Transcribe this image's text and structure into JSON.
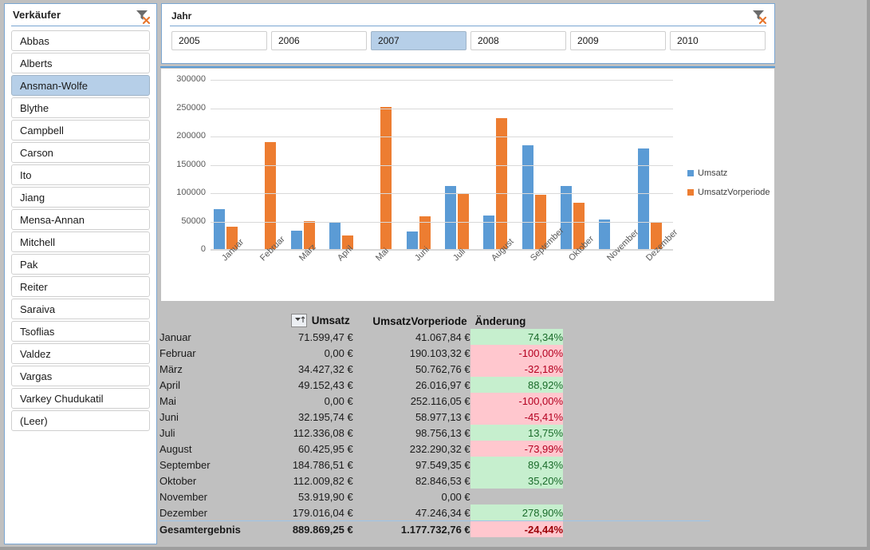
{
  "seller_slicer": {
    "title": "Verkäufer",
    "clear_filter_icon": "clear-filter-funnel-icon",
    "selected": "Ansman-Wolfe",
    "items": [
      "Abbas",
      "Alberts",
      "Ansman-Wolfe",
      "Blythe",
      "Campbell",
      "Carson",
      "Ito",
      "Jiang",
      "Mensa-Annan",
      "Mitchell",
      "Pak",
      "Reiter",
      "Saraiva",
      "Tsoflias",
      "Valdez",
      "Vargas",
      "Varkey Chudukatil",
      "(Leer)"
    ]
  },
  "year_slicer": {
    "title": "Jahr",
    "clear_filter_icon": "clear-filter-funnel-icon",
    "selected": "2007",
    "items": [
      "2005",
      "2006",
      "2007",
      "2008",
      "2009",
      "2010"
    ]
  },
  "chart_data": {
    "type": "bar",
    "title": "",
    "xlabel": "",
    "ylabel": "",
    "ylim": [
      0,
      300000
    ],
    "yticks": [
      0,
      50000,
      100000,
      150000,
      200000,
      250000,
      300000
    ],
    "ytick_labels": [
      "0",
      "50000",
      "100000",
      "150000",
      "200000",
      "250000",
      "300000"
    ],
    "grid": true,
    "legend_position": "right",
    "categories": [
      "Januar",
      "Februar",
      "März",
      "April",
      "Mai",
      "Juni",
      "Juli",
      "August",
      "September",
      "Oktober",
      "November",
      "Dezember"
    ],
    "series": [
      {
        "name": "Umsatz",
        "color": "#5b9bd5",
        "values": [
          71599.47,
          0,
          34427.32,
          49152.43,
          0,
          32195.74,
          112336.08,
          60425.95,
          184786.51,
          112009.82,
          53919.9,
          179016.04
        ]
      },
      {
        "name": "UmsatzVorperiode",
        "color": "#ed7d31",
        "values": [
          41067.84,
          190103.32,
          50762.76,
          26016.97,
          252116.05,
          58977.13,
          98756.13,
          232290.32,
          97549.35,
          82846.53,
          0,
          47246.34
        ]
      }
    ]
  },
  "cursor": {
    "icon": "move-cursor-icon"
  },
  "pivot": {
    "sort_button_icon": "sort-filter-dropdown-icon",
    "headers": {
      "row": "",
      "umsatz": "Umsatz",
      "vorperiode": "UmsatzVorperiode",
      "aenderung": "Änderung"
    },
    "rows": [
      {
        "label": "Januar",
        "umsatz": "71.599,47 €",
        "vorperiode": "41.067,84 €",
        "aenderung": "74,34%",
        "state": "pos"
      },
      {
        "label": "Februar",
        "umsatz": "0,00 €",
        "vorperiode": "190.103,32 €",
        "aenderung": "-100,00%",
        "state": "neg"
      },
      {
        "label": "März",
        "umsatz": "34.427,32 €",
        "vorperiode": "50.762,76 €",
        "aenderung": "-32,18%",
        "state": "neg"
      },
      {
        "label": "April",
        "umsatz": "49.152,43 €",
        "vorperiode": "26.016,97 €",
        "aenderung": "88,92%",
        "state": "pos"
      },
      {
        "label": "Mai",
        "umsatz": "0,00 €",
        "vorperiode": "252.116,05 €",
        "aenderung": "-100,00%",
        "state": "neg"
      },
      {
        "label": "Juni",
        "umsatz": "32.195,74 €",
        "vorperiode": "58.977,13 €",
        "aenderung": "-45,41%",
        "state": "neg"
      },
      {
        "label": "Juli",
        "umsatz": "112.336,08 €",
        "vorperiode": "98.756,13 €",
        "aenderung": "13,75%",
        "state": "pos"
      },
      {
        "label": "August",
        "umsatz": "60.425,95 €",
        "vorperiode": "232.290,32 €",
        "aenderung": "-73,99%",
        "state": "neg"
      },
      {
        "label": "September",
        "umsatz": "184.786,51 €",
        "vorperiode": "97.549,35 €",
        "aenderung": "89,43%",
        "state": "pos"
      },
      {
        "label": "Oktober",
        "umsatz": "112.009,82 €",
        "vorperiode": "82.846,53 €",
        "aenderung": "35,20%",
        "state": "pos"
      },
      {
        "label": "November",
        "umsatz": "53.919,90 €",
        "vorperiode": "0,00 €",
        "aenderung": "",
        "state": "blank"
      },
      {
        "label": "Dezember",
        "umsatz": "179.016,04 €",
        "vorperiode": "47.246,34 €",
        "aenderung": "278,90%",
        "state": "pos"
      }
    ],
    "total": {
      "label": "Gesamtergebnis",
      "umsatz": "889.869,25 €",
      "vorperiode": "1.177.732,76 €",
      "aenderung": "-24,44%",
      "state": "neg"
    }
  }
}
